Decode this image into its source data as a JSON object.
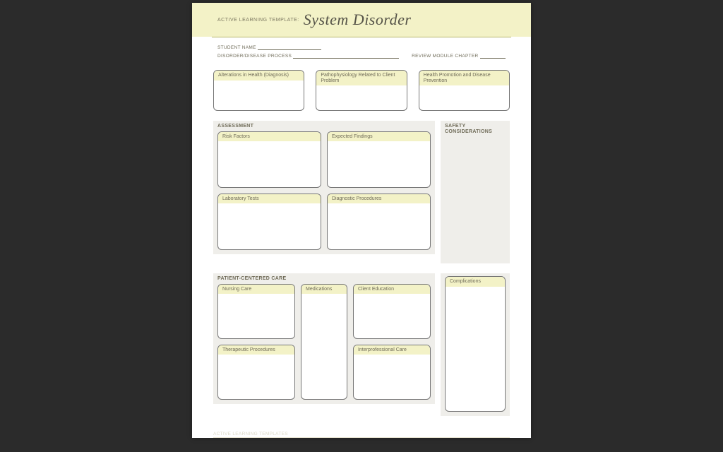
{
  "header": {
    "prefix": "ACTIVE LEARNING TEMPLATE:",
    "title": "System Disorder"
  },
  "meta": {
    "student_name_label": "STUDENT NAME",
    "disorder_label": "DISORDER/DISEASE PROCESS",
    "review_label": "REVIEW MODULE CHAPTER"
  },
  "top_row": {
    "alterations": "Alterations in Health (Diagnosis)",
    "patho": "Pathophysiology Related to Client Problem",
    "promotion": "Health Promotion and Disease Prevention"
  },
  "assessment": {
    "section": "ASSESSMENT",
    "risk_factors": "Risk Factors",
    "expected_findings": "Expected Findings",
    "laboratory_tests": "Laboratory Tests",
    "diagnostic_procedures": "Diagnostic Procedures"
  },
  "safety": {
    "section_line1": "SAFETY",
    "section_line2": "CONSIDERATIONS"
  },
  "pcc": {
    "section": "PATIENT-CENTERED CARE",
    "nursing_care": "Nursing Care",
    "medications": "Medications",
    "client_education": "Client Education",
    "therapeutic_procedures": "Therapeutic Procedures",
    "interprofessional_care": "Interprofessional Care"
  },
  "complications": {
    "label": "Complications"
  },
  "footer": "ACTIVE LEARNING TEMPLATES"
}
